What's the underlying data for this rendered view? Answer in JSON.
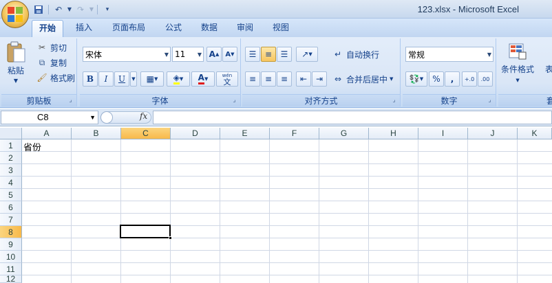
{
  "window": {
    "title": "123.xlsx - Microsoft Excel"
  },
  "qat": {
    "save_icon": "save-icon",
    "undo_icon": "undo-icon",
    "redo_icon": "redo-icon",
    "customize_icon": "customize-qat-icon"
  },
  "tabs": [
    "开始",
    "插入",
    "页面布局",
    "公式",
    "数据",
    "审阅",
    "视图"
  ],
  "ribbon": {
    "clipboard": {
      "paste": "粘贴",
      "cut": "剪切",
      "copy": "复制",
      "format_painter": "格式刷",
      "label": "剪贴板"
    },
    "font": {
      "name": "宋体",
      "size": "11",
      "bold": "B",
      "italic": "I",
      "underline": "U",
      "font_color_glyph": "A",
      "phonetic_glyph": "wén",
      "phonetic_char": "文",
      "label": "字体"
    },
    "alignment": {
      "wrap": "自动换行",
      "merge": "合并后居中",
      "label": "对齐方式"
    },
    "number": {
      "format": "常规",
      "percent": "%",
      "comma": ",",
      "inc_decimal": "+.0",
      "dec_decimal": ".00",
      "label": "数字"
    },
    "styles": {
      "conditional": "条件格式",
      "table_partial": "表格",
      "next_partial": "套"
    }
  },
  "formula_bar": {
    "name_box": "C8",
    "fx_label": "fx",
    "formula": ""
  },
  "sheet": {
    "columns": [
      "A",
      "B",
      "C",
      "D",
      "E",
      "F",
      "G",
      "H",
      "I",
      "J",
      "K"
    ],
    "rows": [
      "1",
      "2",
      "3",
      "4",
      "5",
      "6",
      "7",
      "8",
      "9",
      "10",
      "11",
      "12"
    ],
    "cells": {
      "A1": "省份"
    },
    "selected_cell": "C8",
    "selection_color": "#f8b94a"
  }
}
